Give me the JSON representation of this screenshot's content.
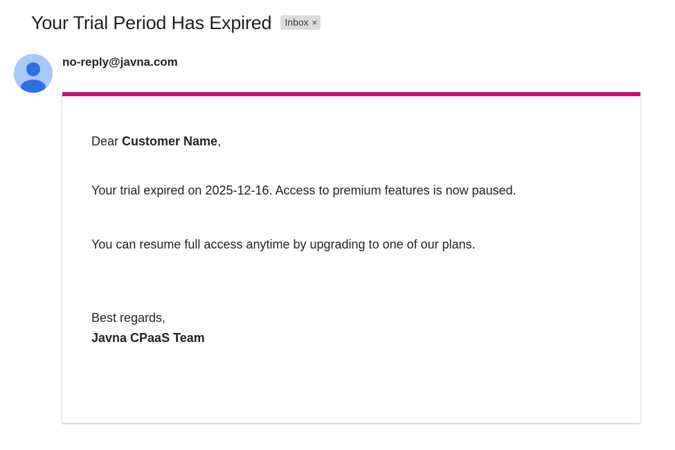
{
  "email": {
    "subject": "Your Trial Period Has Expired",
    "label": "Inbox",
    "label_close": "×",
    "sender": "no-reply@javna.com",
    "avatar_icon": "person-icon"
  },
  "message": {
    "greeting_prefix": "Dear ",
    "customer_name": "Customer Name",
    "greeting_suffix": ",",
    "line1": "Your trial expired on 2025-12-16. Access to premium features is now paused.",
    "line2": "You can resume full access anytime by upgrading to one of our plans.",
    "signoff": "Best regards,",
    "team": "Javna CPaaS Team"
  },
  "colors": {
    "accent_bar": "#c8107a",
    "avatar_bg": "#a8c7fa",
    "avatar_fg": "#2f6fe4",
    "chip_bg": "#dcdcdc"
  }
}
